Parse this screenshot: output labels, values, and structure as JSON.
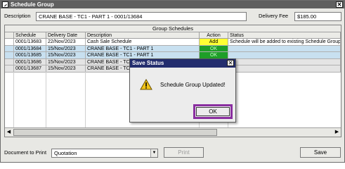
{
  "window": {
    "title": "Schedule Group",
    "close": "✕"
  },
  "header": {
    "description_label": "Description",
    "description_value": "CRANE BASE - TC1 - PART 1 - 0001/13684",
    "delivery_fee_label": "Delivery Fee",
    "delivery_fee_value": "$185.00"
  },
  "grid": {
    "group_title": "Group Schedules",
    "columns": [
      "Schedule",
      "Delivery Date",
      "Description",
      "Action",
      "Status"
    ],
    "rows": [
      {
        "schedule": "0001/13683",
        "date": "22/Nov/2023",
        "description": "Cash Sale Schedule",
        "action": "Add",
        "status": "Schedule will be added to existing Schedule Group"
      },
      {
        "schedule": "0001/13684",
        "date": "15/Nov/2023",
        "description": "CRANE BASE - TC1 - PART 1",
        "action": "OK",
        "status": ""
      },
      {
        "schedule": "0001/13685",
        "date": "15/Nov/2023",
        "description": "CRANE BASE - TC1 - PART 1",
        "action": "OK",
        "status": ""
      },
      {
        "schedule": "0001/13686",
        "date": "15/Nov/2023",
        "description": "CRANE BASE - TC",
        "action": "",
        "status": ""
      },
      {
        "schedule": "0001/13687",
        "date": "15/Nov/2023",
        "description": "CRANE BASE - TC",
        "action": "",
        "status": ""
      }
    ]
  },
  "footer": {
    "doc_label": "Document to Print",
    "doc_value": "Quotation",
    "print_label": "Print",
    "save_label": "Save"
  },
  "dialog": {
    "title": "Save Status",
    "close": "✕",
    "message": "Schedule Group Updated!",
    "ok_label": "OK"
  },
  "colors": {
    "title_bar": "#5f5f5f",
    "dialog_title": "#232d6e",
    "row_selected": "#c8e0f0",
    "action_add": "#ffff33",
    "action_ok": "#1e9e28",
    "highlight_ring": "#8a2fa0"
  }
}
